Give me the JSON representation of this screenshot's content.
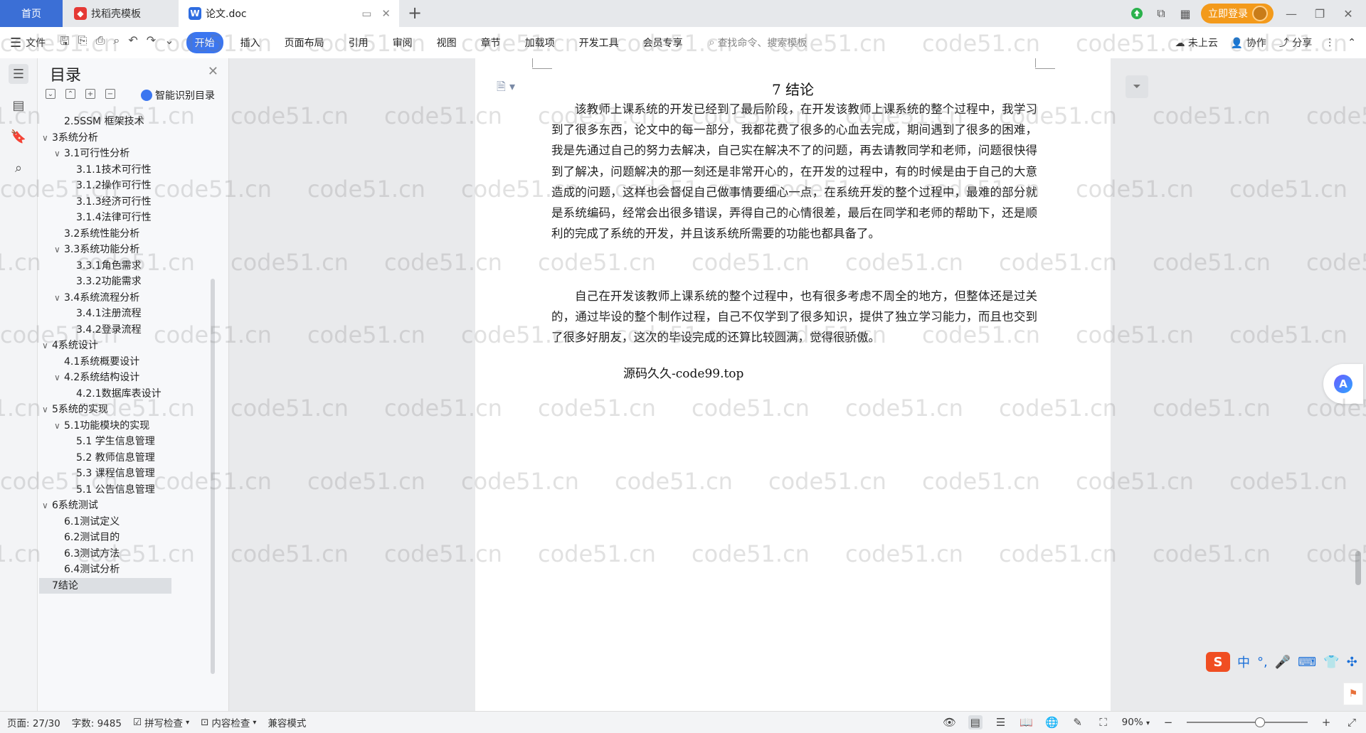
{
  "titlebar": {
    "tabs": [
      {
        "label": "首页"
      },
      {
        "label": "找稻壳模板"
      },
      {
        "label": "论文.doc"
      }
    ],
    "new_tab": "+",
    "login_label": "立即登录",
    "window_controls": [
      "—",
      "❐",
      "✕"
    ]
  },
  "ribbon": {
    "file_label": "文件",
    "tabs": [
      "开始",
      "插入",
      "页面布局",
      "引用",
      "审阅",
      "视图",
      "章节",
      "加载项",
      "开发工具",
      "会员专享"
    ],
    "active_tab": "开始",
    "search_placeholder": "查找命令、搜索模板",
    "right": {
      "cloud": "未上云",
      "collab": "协作",
      "share": "分享"
    }
  },
  "toc": {
    "title": "目录",
    "smart_label": "智能识别目录",
    "items": [
      {
        "label": "2.5SSM 框架技术",
        "level": 2,
        "caret": ""
      },
      {
        "label": "3系统分析",
        "level": 1,
        "caret": "∨"
      },
      {
        "label": "3.1可行性分析",
        "level": 2,
        "caret": "∨"
      },
      {
        "label": "3.1.1技术可行性",
        "level": 3,
        "caret": ""
      },
      {
        "label": "3.1.2操作可行性",
        "level": 3,
        "caret": ""
      },
      {
        "label": "3.1.3经济可行性",
        "level": 3,
        "caret": ""
      },
      {
        "label": "3.1.4法律可行性",
        "level": 3,
        "caret": ""
      },
      {
        "label": "3.2系统性能分析",
        "level": 2,
        "caret": ""
      },
      {
        "label": "3.3系统功能分析",
        "level": 2,
        "caret": "∨"
      },
      {
        "label": "3.3.1角色需求",
        "level": 3,
        "caret": ""
      },
      {
        "label": "3.3.2功能需求",
        "level": 3,
        "caret": ""
      },
      {
        "label": "3.4系统流程分析",
        "level": 2,
        "caret": "∨"
      },
      {
        "label": "3.4.1注册流程",
        "level": 3,
        "caret": ""
      },
      {
        "label": "3.4.2登录流程",
        "level": 3,
        "caret": ""
      },
      {
        "label": "4系统设计",
        "level": 1,
        "caret": "∨"
      },
      {
        "label": "4.1系统概要设计",
        "level": 2,
        "caret": ""
      },
      {
        "label": "4.2系统结构设计",
        "level": 2,
        "caret": "∨"
      },
      {
        "label": "4.2.1数据库表设计",
        "level": 3,
        "caret": ""
      },
      {
        "label": "5系统的实现",
        "level": 1,
        "caret": "∨"
      },
      {
        "label": "5.1功能模块的实现",
        "level": 2,
        "caret": "∨"
      },
      {
        "label": "5.1 学生信息管理",
        "level": 3,
        "caret": ""
      },
      {
        "label": "5.2  教师信息管理",
        "level": 3,
        "caret": ""
      },
      {
        "label": "5.3 课程信息管理",
        "level": 3,
        "caret": ""
      },
      {
        "label": "5.1 公告信息管理",
        "level": 3,
        "caret": ""
      },
      {
        "label": "6系统测试",
        "level": 1,
        "caret": "∨"
      },
      {
        "label": "6.1测试定义",
        "level": 2,
        "caret": ""
      },
      {
        "label": "6.2测试目的",
        "level": 2,
        "caret": ""
      },
      {
        "label": "6.3测试方法",
        "level": 2,
        "caret": ""
      },
      {
        "label": "6.4测试分析",
        "level": 2,
        "caret": ""
      },
      {
        "label": "7结论",
        "level": 1,
        "caret": "",
        "selected": true
      }
    ]
  },
  "document": {
    "heading": "7  结论",
    "paragraphs": [
      "该教师上课系统的开发已经到了最后阶段，在开发该教师上课系统的整个过程中，我学习到了很多东西，论文中的每一部分，我都花费了很多的心血去完成，期间遇到了很多的困难，我是先通过自己的努力去解决，自己实在解决不了的问题，再去请教同学和老师，问题很快得到了解决，问题解决的那一刻还是非常开心的，在开发的过程中，有的时候是由于自己的大意造成的问题，这样也会督促自己做事情要细心一点，在系统开发的整个过程中，最难的部分就是系统编码，经常会出很多错误，弄得自己的心情很差，最后在同学和老师的帮助下，还是顺利的完成了系统的开发，并且该系统所需要的功能也都具备了。",
      "自己在开发该教师上课系统的整个过程中，也有很多考虑不周全的地方，但整体还是过关的，通过毕设的整个制作过程，自己不仅学到了很多知识，提供了独立学习能力，而且也交到了很多好朋友，这次的毕设完成的还算比较圆满，觉得很骄傲。"
    ],
    "footer_note": "源码久久-code99.top"
  },
  "watermark": "code51.cn",
  "ime": {
    "mode": "中"
  },
  "status": {
    "page": "页面: 27/30",
    "words": "字数: 9485",
    "spell": "拼写检查",
    "content_check": "内容检查",
    "compat": "兼容模式",
    "zoom": "90%",
    "zoom_level": 0.6
  },
  "colors": {
    "accent": "#3b76f0",
    "home_tab": "#3b6fd6",
    "login": "#f39a1b"
  }
}
